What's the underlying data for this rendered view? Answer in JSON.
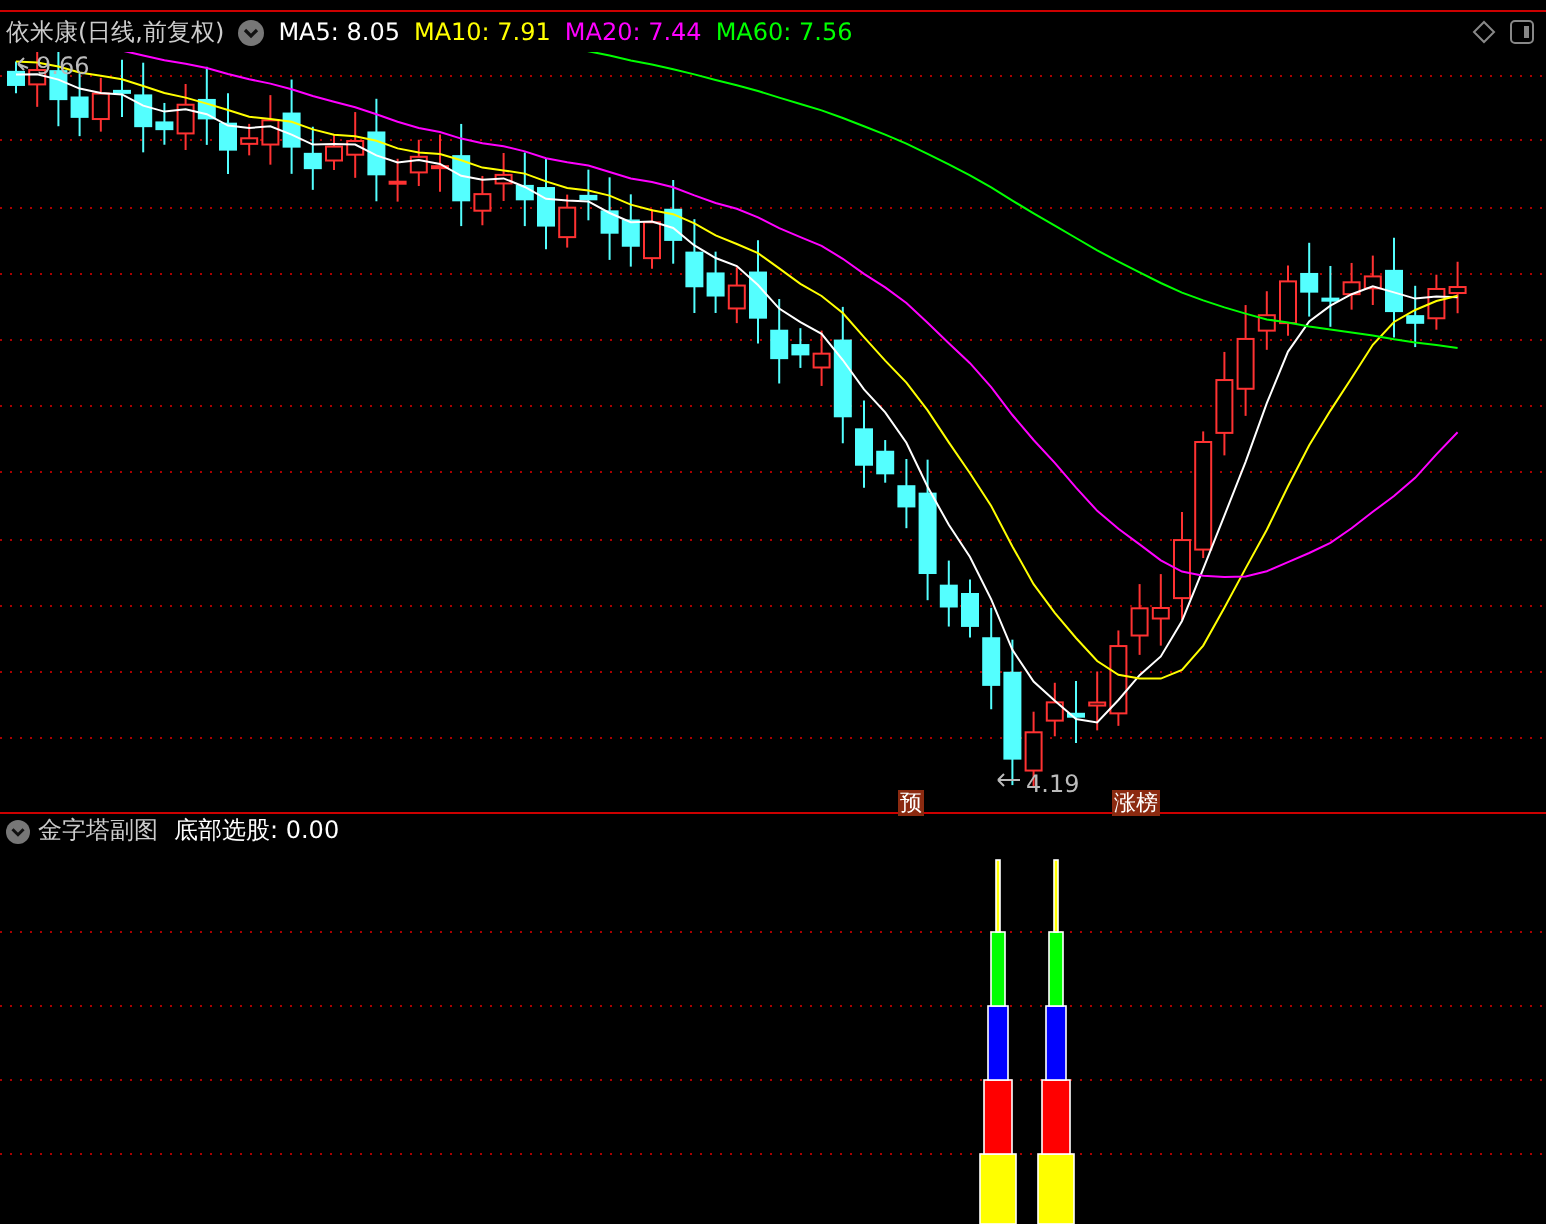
{
  "header": {
    "title": "依米康(日线,前复权)",
    "indicators": [
      {
        "label": "MA5: 8.05",
        "color": "#ffffff"
      },
      {
        "label": "MA10: 7.91",
        "color": "#ffff00"
      },
      {
        "label": "MA20: 7.44",
        "color": "#ff00ff"
      },
      {
        "label": "MA60: 7.56",
        "color": "#00ff00"
      }
    ]
  },
  "price_chart": {
    "high_label": "9.66",
    "low_label": "4.19",
    "markers": [
      "预",
      "涨榜"
    ]
  },
  "sub_chart": {
    "title": "金字塔副图",
    "indicator": "底部选股: 0.00"
  }
}
